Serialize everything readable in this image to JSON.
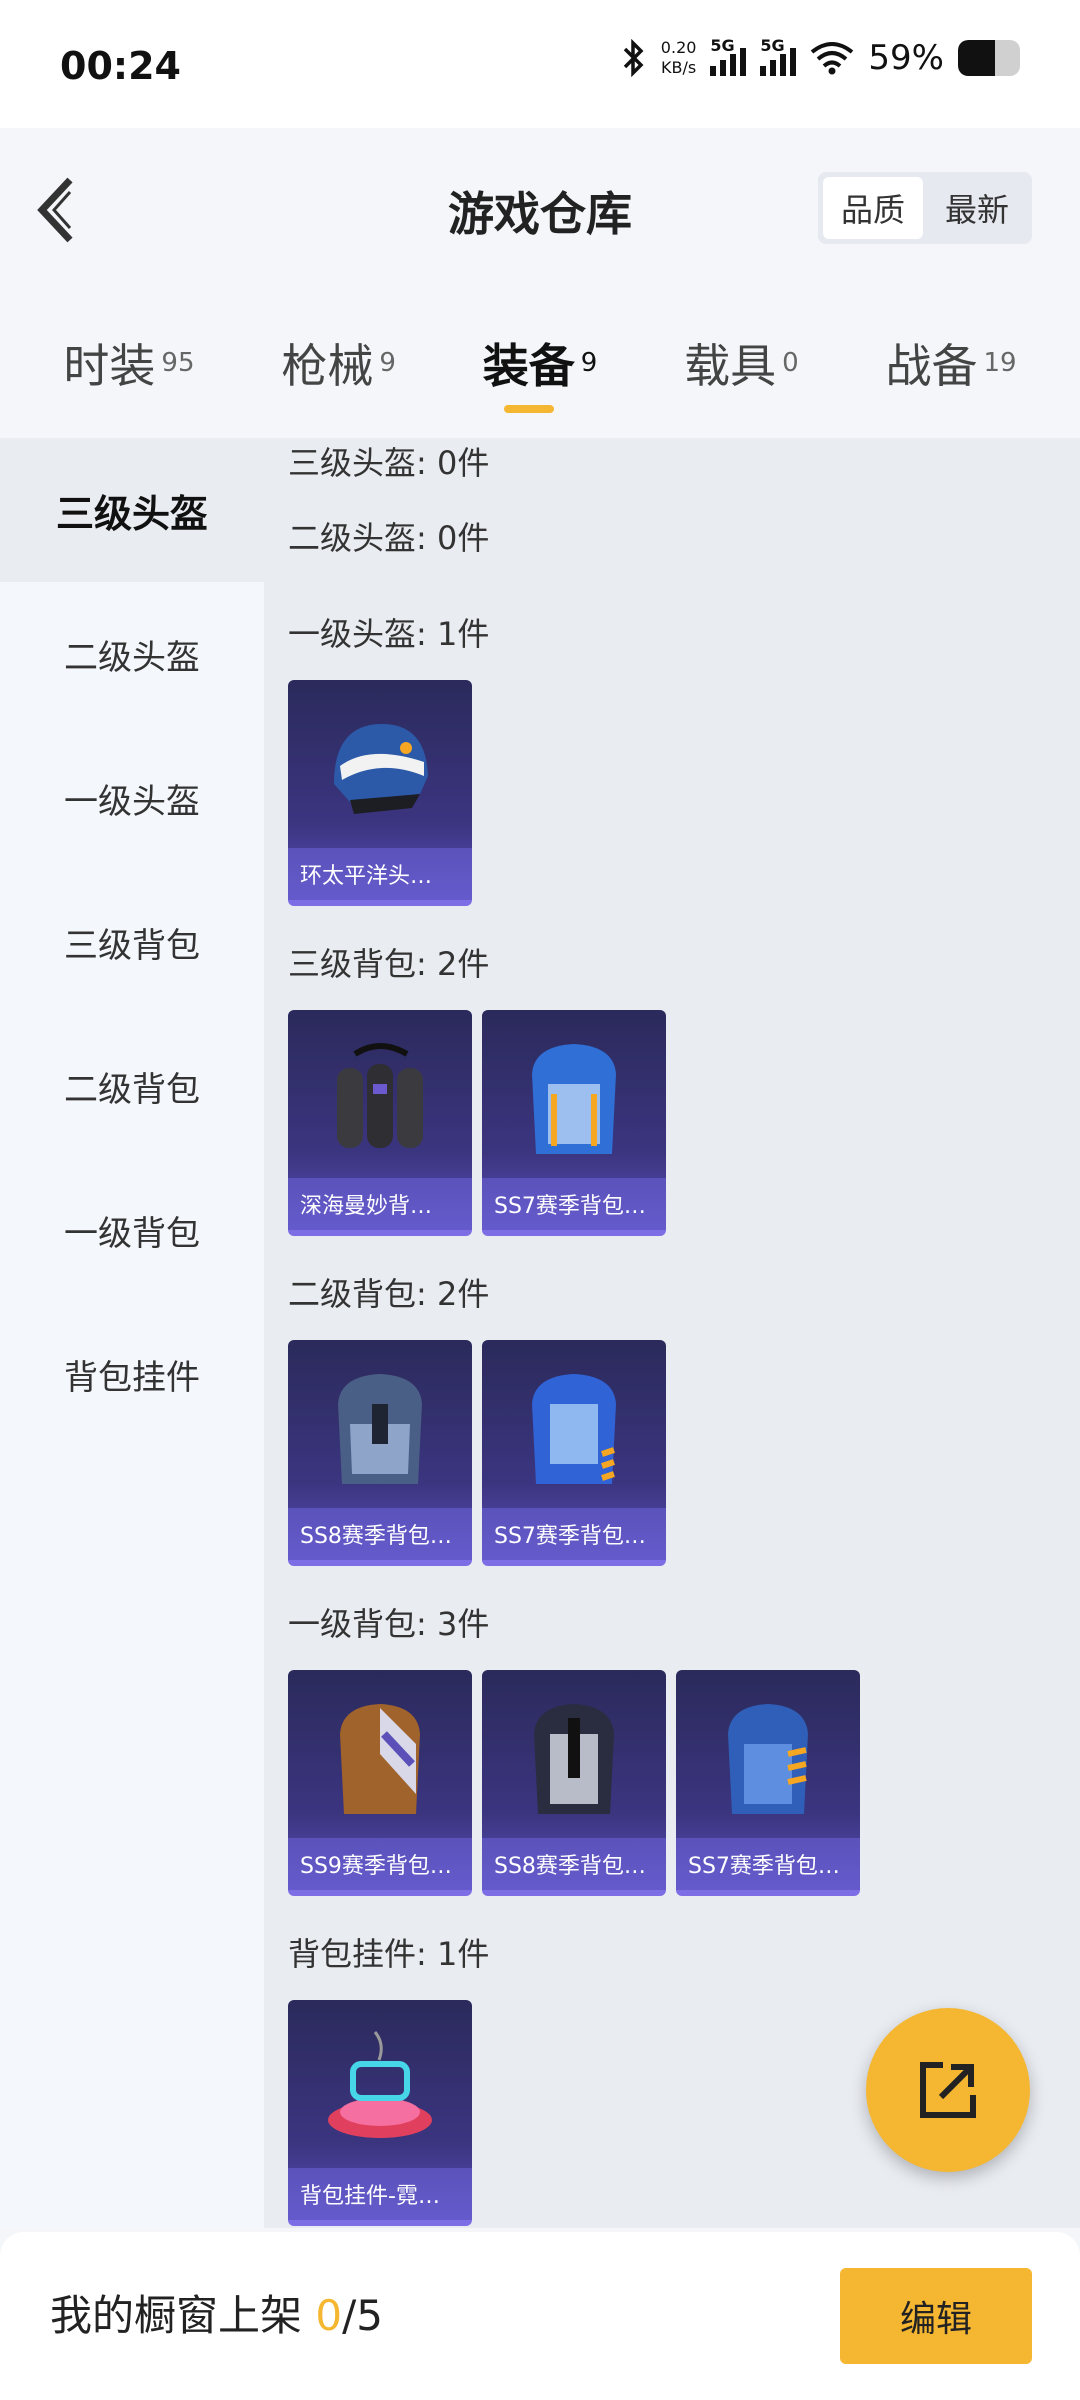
{
  "status": {
    "time": "00:24",
    "net_speed_value": "0.20",
    "net_speed_unit": "KB/s",
    "sim1": "5G",
    "sim2": "5G",
    "battery": "59%",
    "battery_level": 0.59
  },
  "header": {
    "title": "游戏仓库",
    "sort_quality": "品质",
    "sort_newest": "最新"
  },
  "tabs": [
    {
      "label": "时装",
      "count": "95"
    },
    {
      "label": "枪械",
      "count": "9"
    },
    {
      "label": "装备",
      "count": "9"
    },
    {
      "label": "载具",
      "count": "0"
    },
    {
      "label": "战备",
      "count": "19"
    }
  ],
  "sidebar": {
    "items": [
      "三级头盔",
      "二级头盔",
      "一级头盔",
      "三级背包",
      "二级背包",
      "一级背包",
      "背包挂件"
    ]
  },
  "groups": [
    {
      "title": "三级头盔: 0件",
      "items": []
    },
    {
      "title": "二级头盔: 0件",
      "items": []
    },
    {
      "title": "一级头盔: 1件",
      "items": [
        "环太平洋头…"
      ]
    },
    {
      "title": "三级背包: 2件",
      "items": [
        "深海曼妙背…",
        "SS7赛季背包…"
      ]
    },
    {
      "title": "二级背包: 2件",
      "items": [
        "SS8赛季背包…",
        "SS7赛季背包…"
      ]
    },
    {
      "title": "一级背包: 3件",
      "items": [
        "SS9赛季背包…",
        "SS8赛季背包…",
        "SS7赛季背包…"
      ]
    },
    {
      "title": "背包挂件: 1件",
      "items": [
        "背包挂件-霓…"
      ]
    }
  ],
  "footer": {
    "shelf_label": "我的橱窗上架",
    "shelf_count": "0",
    "shelf_total": "/5",
    "edit_button": "编辑"
  },
  "colors": {
    "accent": "#f5b731",
    "card_bg": "#3b3580"
  }
}
